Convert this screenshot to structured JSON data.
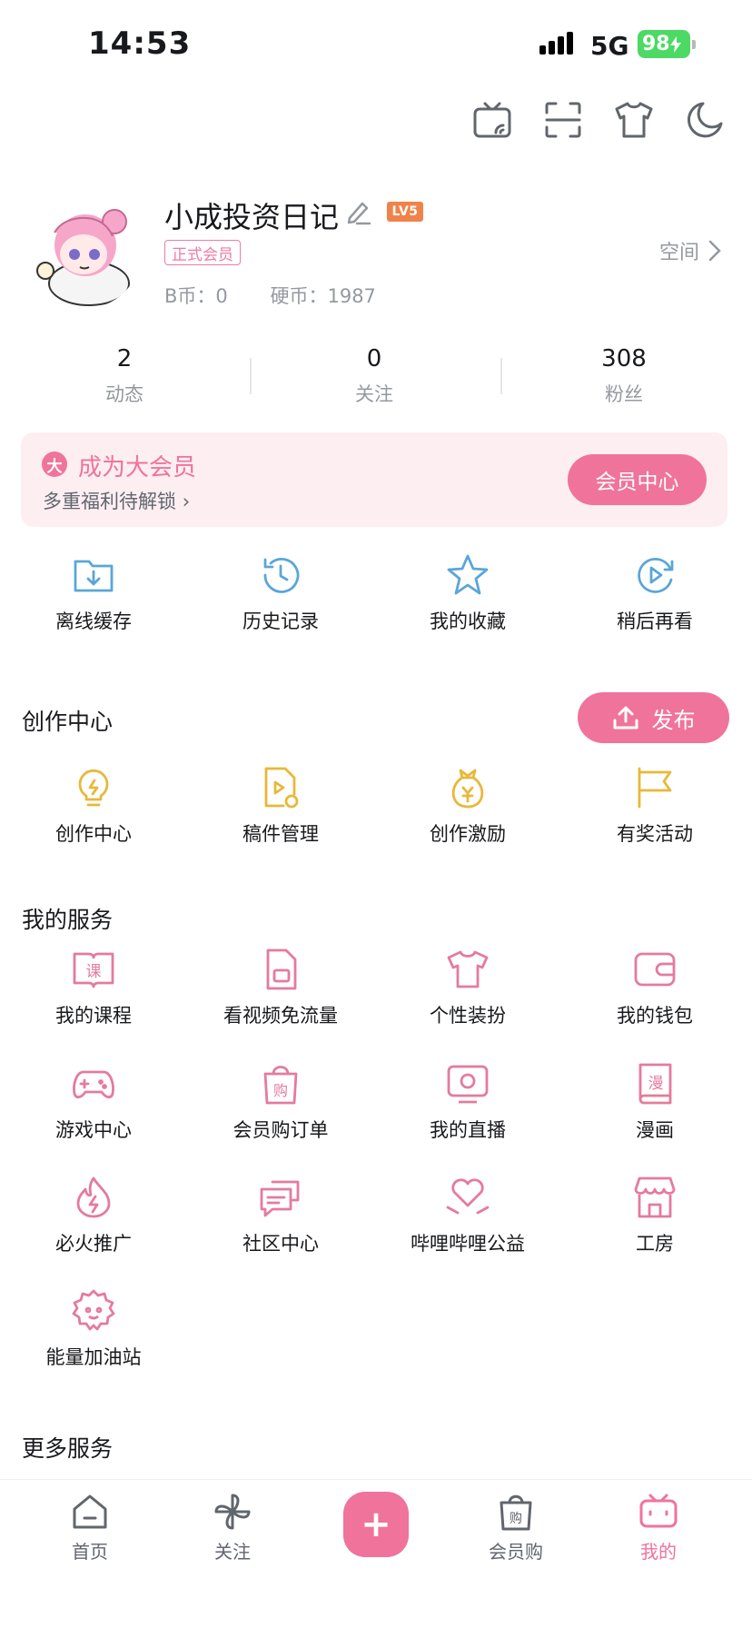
{
  "status_bar": {
    "time": "14:53",
    "network": "5G",
    "battery": "98"
  },
  "top_icons": [
    "tv-cast-icon",
    "scan-icon",
    "tshirt-icon",
    "moon-icon"
  ],
  "profile": {
    "username": "小成投资日记",
    "level": "LV5",
    "member_tag": "正式会员",
    "b_coins": "B币：0",
    "hard_coins": "硬币：1987",
    "space_link": "空间"
  },
  "stats": [
    {
      "value": "2",
      "label": "动态"
    },
    {
      "value": "0",
      "label": "关注"
    },
    {
      "value": "308",
      "label": "粉丝"
    }
  ],
  "vip": {
    "icon_text": "大",
    "title": "成为大会员",
    "subtitle": "多重福利待解锁",
    "button": "会员中心"
  },
  "quick_actions": [
    {
      "label": "离线缓存",
      "icon": "download-folder-icon"
    },
    {
      "label": "历史记录",
      "icon": "history-icon"
    },
    {
      "label": "我的收藏",
      "icon": "star-icon"
    },
    {
      "label": "稍后再看",
      "icon": "watch-later-icon"
    }
  ],
  "creation": {
    "title": "创作中心",
    "publish_button": "发布",
    "items": [
      {
        "label": "创作中心",
        "icon": "lightbulb-icon"
      },
      {
        "label": "稿件管理",
        "icon": "manuscript-icon"
      },
      {
        "label": "创作激励",
        "icon": "money-bag-icon"
      },
      {
        "label": "有奖活动",
        "icon": "flag-icon"
      }
    ]
  },
  "services": {
    "title": "我的服务",
    "items": [
      {
        "label": "我的课程",
        "icon": "course-icon"
      },
      {
        "label": "看视频免流量",
        "icon": "sim-card-icon"
      },
      {
        "label": "个性装扮",
        "icon": "tshirt-icon"
      },
      {
        "label": "我的钱包",
        "icon": "wallet-icon"
      },
      {
        "label": "游戏中心",
        "icon": "gamepad-icon"
      },
      {
        "label": "会员购订单",
        "icon": "shopping-bag-icon"
      },
      {
        "label": "我的直播",
        "icon": "live-tv-icon"
      },
      {
        "label": "漫画",
        "icon": "comic-book-icon"
      },
      {
        "label": "必火推广",
        "icon": "fire-icon"
      },
      {
        "label": "社区中心",
        "icon": "chat-bubbles-icon"
      },
      {
        "label": "哔哩哔哩公益",
        "icon": "heart-hands-icon"
      },
      {
        "label": "工房",
        "icon": "shop-icon"
      },
      {
        "label": "能量加油站",
        "icon": "energy-flower-icon"
      }
    ]
  },
  "more_services": {
    "title": "更多服务"
  },
  "bottom_nav": [
    {
      "label": "首页",
      "icon": "home-icon"
    },
    {
      "label": "关注",
      "icon": "pinwheel-icon"
    },
    {
      "label": "",
      "icon": "plus-icon"
    },
    {
      "label": "会员购",
      "icon": "shopping-bag-icon"
    },
    {
      "label": "我的",
      "icon": "bilibili-tv-icon"
    }
  ],
  "colors": {
    "pink": "#f0739b",
    "blue": "#5aa6d8",
    "gold": "#e8b83a",
    "gray": "#9499a0"
  }
}
